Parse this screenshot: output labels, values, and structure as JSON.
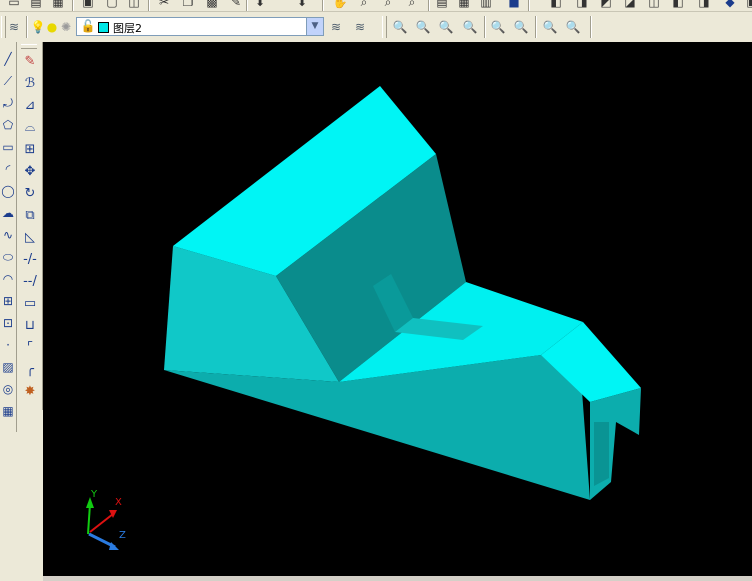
{
  "layer_toolbar": {
    "current_layer": "图层2",
    "layer_color": "#00e5e5"
  },
  "icons": {
    "top": [
      "new-icon",
      "open-icon",
      "save-icon",
      "print-icon",
      "preview-icon",
      "publish-icon",
      "cut-icon",
      "copy-icon",
      "paste-icon",
      "match-icon",
      "undo-icon",
      "redo-icon",
      "pan-icon",
      "zoom-icon",
      "zoom-window-icon",
      "zoom-previous-icon",
      "properties-icon",
      "design-center-icon",
      "tool-palette-icon",
      "help-icon",
      "view-front-icon",
      "view-top-icon",
      "view-left-icon",
      "view-right-icon",
      "view-iso-icon",
      "render-icon"
    ],
    "zoom": [
      "zoom-realtime-icon",
      "zoom-window-icon",
      "zoom-dynamic-icon",
      "zoom-scale-icon",
      "zoom-in-icon",
      "zoom-out-icon",
      "zoom-all-icon",
      "zoom-extents-icon"
    ]
  },
  "colors": {
    "viewport_bg": "#000000",
    "face_top": "#00f5f5",
    "face_front": "#10c8c8",
    "face_dark": "#0a8c8c",
    "face_mid": "#0cadad",
    "axis_x": "#d11",
    "axis_y": "#1c1",
    "axis_z": "#2a7be0"
  },
  "ucs": {
    "x_label": "X",
    "y_label": "Y",
    "z_label": "Z"
  }
}
